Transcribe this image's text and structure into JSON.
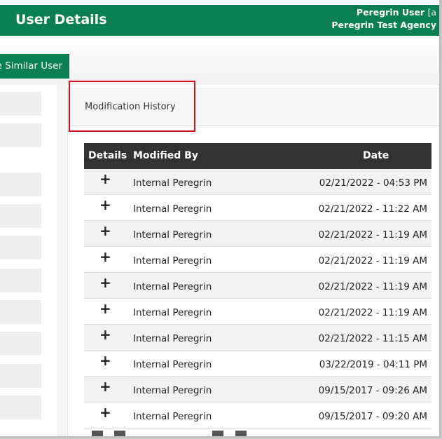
{
  "header": {
    "title": "User Details",
    "user_name": "Peregrin User",
    "user_bracket": "[a",
    "agency": "Peregrin Test Agency"
  },
  "toolbar": {
    "similar_user_label": "e Similar User"
  },
  "panel": {
    "title": "Modification History"
  },
  "table": {
    "columns": {
      "details": "Details",
      "modified_by": "Modified By",
      "date": "Date"
    },
    "rows": [
      {
        "expand": "+",
        "modified_by": "Internal Peregrin",
        "date": "02/21/2022 - 04:53 PM"
      },
      {
        "expand": "+",
        "modified_by": "Internal Peregrin",
        "date": "02/21/2022 - 11:22 AM"
      },
      {
        "expand": "+",
        "modified_by": "Internal Peregrin",
        "date": "02/21/2022 - 11:19 AM"
      },
      {
        "expand": "+",
        "modified_by": "Internal Peregrin",
        "date": "02/21/2022 - 11:19 AM"
      },
      {
        "expand": "+",
        "modified_by": "Internal Peregrin",
        "date": "02/21/2022 - 11:19 AM"
      },
      {
        "expand": "+",
        "modified_by": "Internal Peregrin",
        "date": "02/21/2022 - 11:19 AM"
      },
      {
        "expand": "+",
        "modified_by": "Internal Peregrin",
        "date": "02/21/2022 - 11:15 AM"
      },
      {
        "expand": "+",
        "modified_by": "Internal Peregrin",
        "date": "03/22/2019 - 04:11 PM"
      },
      {
        "expand": "+",
        "modified_by": "Internal Peregrin",
        "date": "09/15/2017 - 09:26 AM"
      },
      {
        "expand": "+",
        "modified_by": "Internal Peregrin",
        "date": "09/15/2017 - 09:20 AM"
      }
    ]
  },
  "colors": {
    "brand_green": "#0a7f4f",
    "table_header": "#333333",
    "highlight_red": "#d6141f"
  }
}
